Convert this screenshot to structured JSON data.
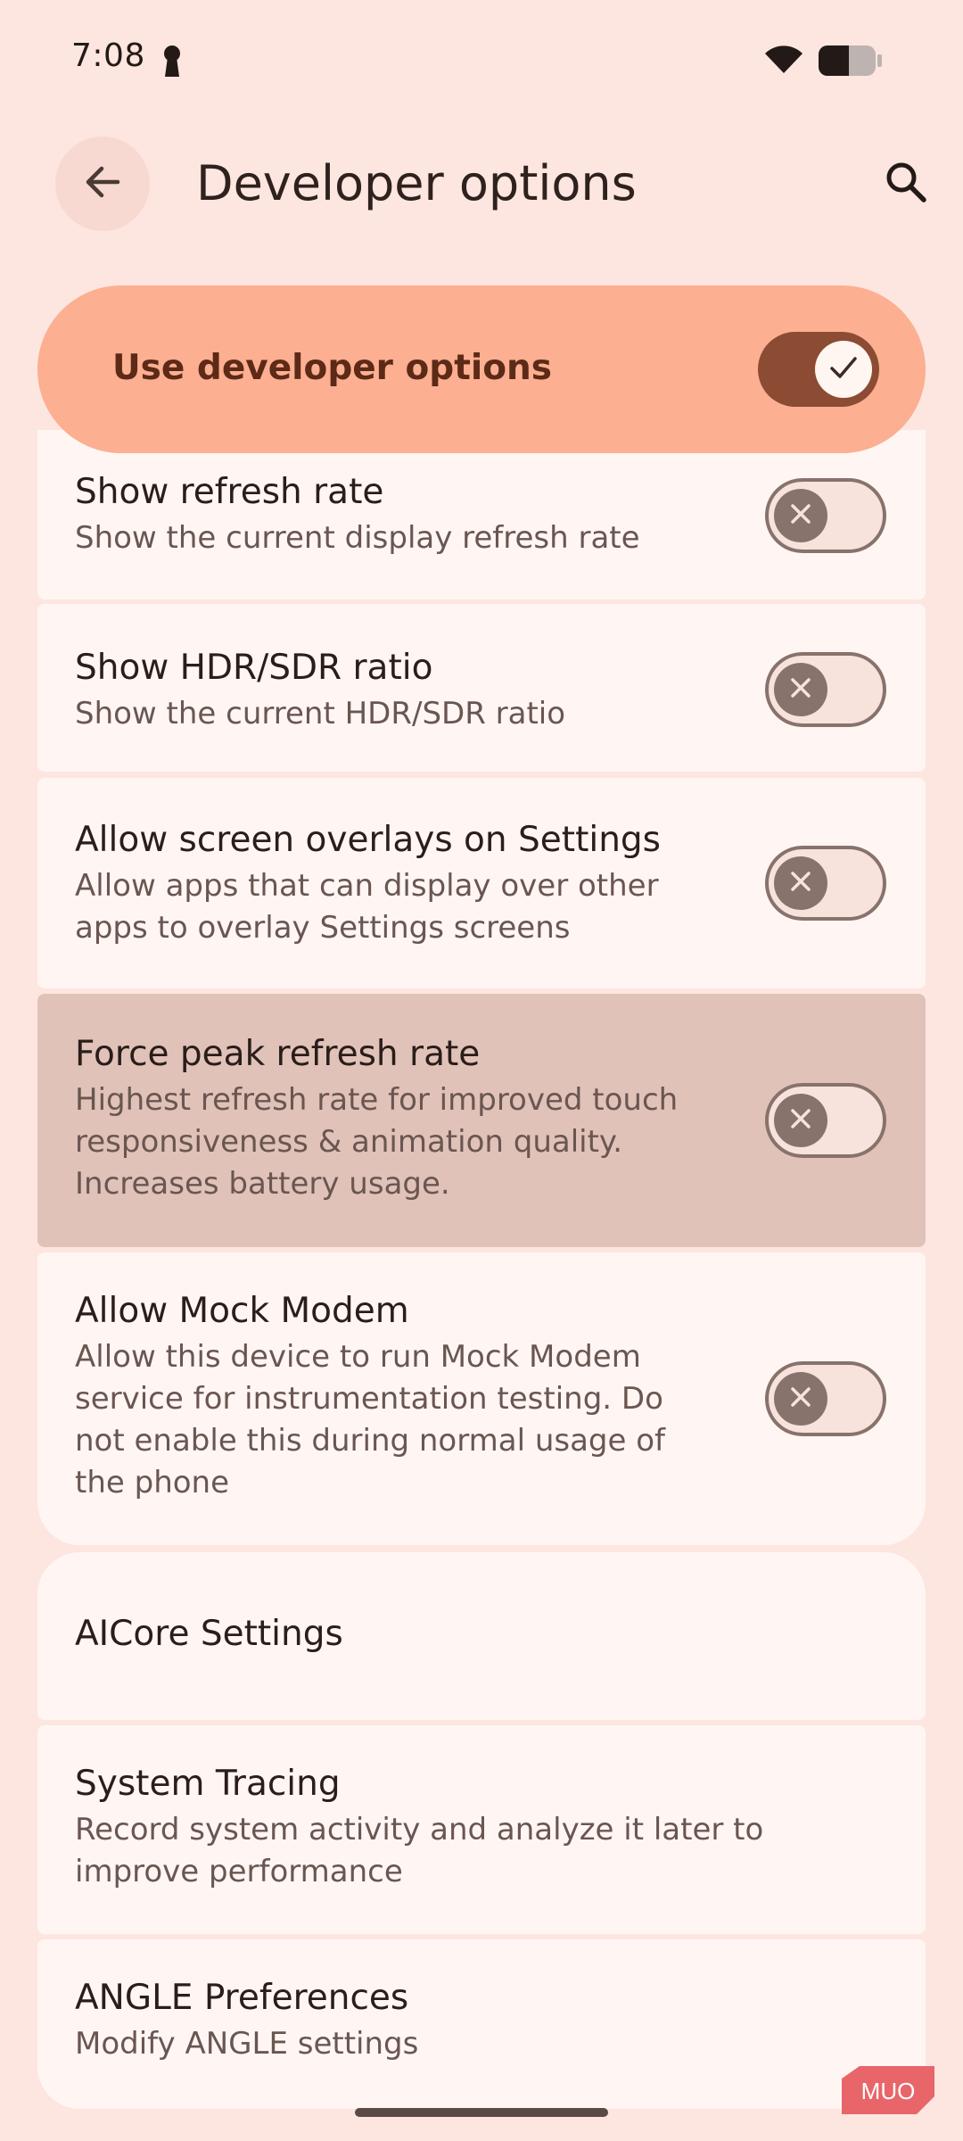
{
  "status_bar": {
    "time": "7:08"
  },
  "header": {
    "title": "Developer options"
  },
  "master_switch": {
    "label": "Use developer options",
    "state": "on"
  },
  "preferences": [
    {
      "title": "Show refresh rate",
      "summary": [
        "Show the current display refresh rate"
      ],
      "toggle": "off"
    },
    {
      "title": "Show HDR/SDR ratio",
      "summary": [
        "Show the current HDR/SDR ratio"
      ],
      "toggle": "off"
    },
    {
      "title": "Allow screen overlays on Settings",
      "summary": [
        "Allow apps that can display over other",
        "apps to overlay Settings screens"
      ],
      "toggle": "off"
    },
    {
      "title": "Force peak refresh rate",
      "summary": [
        "Highest refresh rate for improved touch",
        "responsiveness & animation quality.",
        "Increases battery usage."
      ],
      "toggle": "off",
      "highlighted": true
    },
    {
      "title": "Allow Mock Modem",
      "summary": [
        "Allow this device to run Mock Modem",
        "service for instrumentation testing. Do",
        "not enable this during normal usage of",
        "the phone"
      ],
      "toggle": "off"
    },
    {
      "title": "AICore Settings",
      "summary": []
    },
    {
      "title": "System Tracing",
      "summary": [
        "Record system activity and analyze it later to",
        "improve performance"
      ]
    },
    {
      "title": "ANGLE Preferences",
      "summary": [
        "Modify ANGLE settings"
      ]
    }
  ],
  "watermark": {
    "text": "MUO"
  },
  "colors": {
    "background": "#fde6e0",
    "accent": "#fcaf91",
    "switch_on": "#8c4b33",
    "highlight": "#e0c2b8"
  },
  "icons": [
    "keyhole-icon",
    "wifi-icon",
    "battery-icon",
    "back-arrow-icon",
    "search-icon",
    "check-icon",
    "close-icon"
  ]
}
